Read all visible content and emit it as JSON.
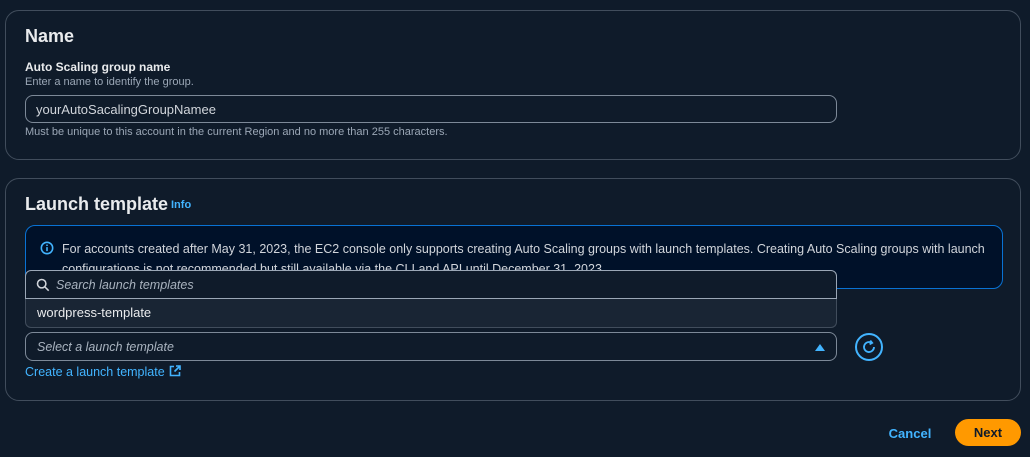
{
  "name_section": {
    "heading": "Name",
    "field_label": "Auto Scaling group name",
    "field_description": "Enter a name to identify the group.",
    "input_value": "yourAutoSacalingGroupNamee",
    "constraint_text": "Must be unique to this account in the current Region and no more than 255 characters."
  },
  "launch_template_section": {
    "heading": "Launch template",
    "info_label": "Info",
    "alert_text": "For accounts created after May 31, 2023, the EC2 console only supports creating Auto Scaling groups with launch templates. Creating Auto Scaling groups with launch configurations is not recommended but still available via the CLI and API until December 31, 2023.",
    "search_placeholder": "Search launch templates",
    "options": [
      "wordpress-template"
    ],
    "select_placeholder": "Select a launch template",
    "create_link_label": "Create a launch template"
  },
  "footer": {
    "cancel_label": "Cancel",
    "next_label": "Next"
  },
  "colors": {
    "background": "#0f1b2a",
    "link": "#42b4ff",
    "primary_button": "#ff9900",
    "info_border": "#0972d3"
  },
  "icons": {
    "alert": "info-circle-icon",
    "search": "search-icon",
    "caret": "caret-up-icon",
    "refresh": "refresh-icon",
    "external": "external-link-icon"
  }
}
